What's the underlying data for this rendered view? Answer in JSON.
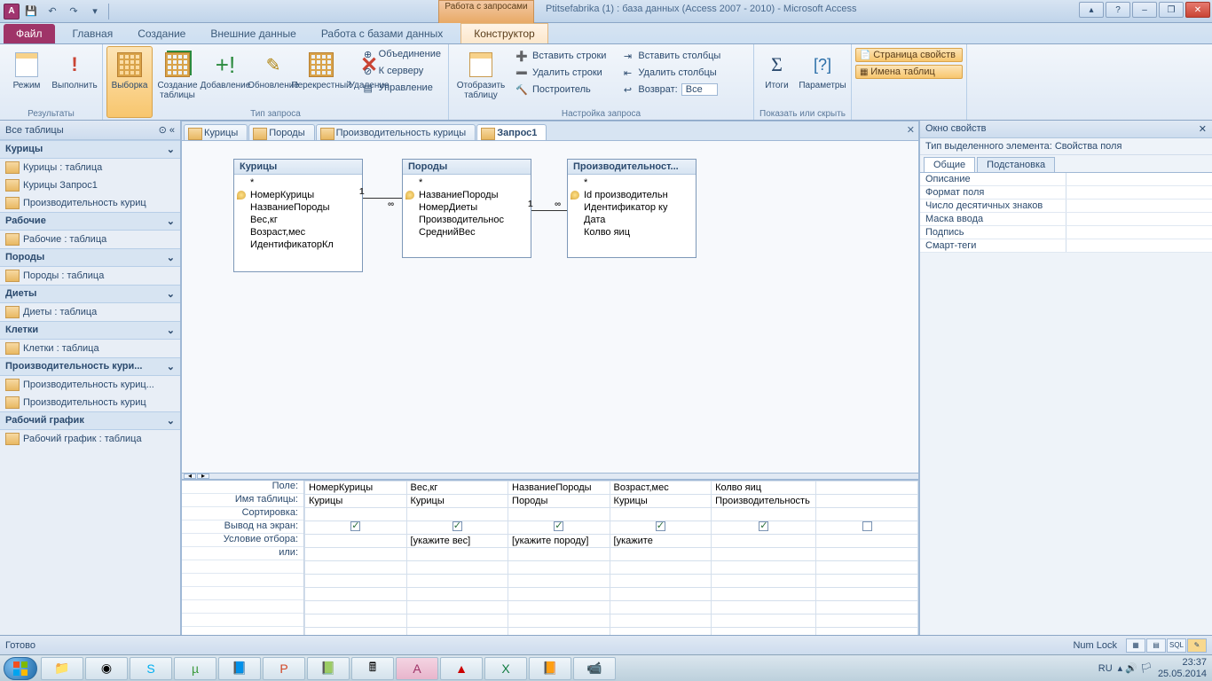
{
  "title": "Ptitsefabrika (1) : база данных (Access 2007 - 2010)  -  Microsoft Access",
  "context_group": "Работа с запросами",
  "tabs": {
    "file": "Файл",
    "home": "Главная",
    "create": "Создание",
    "ext": "Внешние данные",
    "db": "Работа с базами данных",
    "design": "Конструктор"
  },
  "ribbon": {
    "results": {
      "label": "Результаты",
      "view": "Режим",
      "run": "Выполнить"
    },
    "qtype": {
      "label": "Тип запроса",
      "select": "Выборка",
      "maketable": "Создание таблицы",
      "append": "Добавление",
      "update": "Обновление",
      "crosstab": "Перекрестный",
      "delete": "Удаление",
      "union": "Объединение",
      "passthrough": "К серверу",
      "ddl": "Управление"
    },
    "showtable": {
      "btn": "Отобразить таблицу"
    },
    "rows": {
      "insert": "Вставить строки",
      "delete": "Удалить строки",
      "builder": "Построитель"
    },
    "cols": {
      "insert": "Вставить столбцы",
      "delete": "Удалить столбцы",
      "return": "Возврат:",
      "return_val": "Все"
    },
    "setup_label": "Настройка запроса",
    "totals": "Итоги",
    "params": "Параметры",
    "showhide": {
      "label": "Показать или скрыть",
      "propsheet": "Страница свойств",
      "tablenames": "Имена таблиц"
    }
  },
  "nav": {
    "title": "Все таблицы",
    "groups": [
      {
        "h": "Курицы",
        "items": [
          "Курицы : таблица",
          "Курицы Запрос1",
          "Производительность куриц"
        ]
      },
      {
        "h": "Рабочие",
        "items": [
          "Рабочие : таблица"
        ]
      },
      {
        "h": "Породы",
        "items": [
          "Породы : таблица"
        ]
      },
      {
        "h": "Диеты",
        "items": [
          "Диеты : таблица"
        ]
      },
      {
        "h": "Клетки",
        "items": [
          "Клетки : таблица"
        ]
      },
      {
        "h": "Производительность кури...",
        "items": [
          "Производительность куриц...",
          "Производительность куриц"
        ]
      },
      {
        "h": "Рабочий график",
        "items": [
          "Рабочий график : таблица"
        ]
      }
    ]
  },
  "objtabs": [
    "Курицы",
    "Породы",
    "Производительность курицы",
    "Запрос1"
  ],
  "active_tab": 3,
  "tables": [
    {
      "title": "Курицы",
      "fields": [
        "*",
        "НомерКурицы",
        "НазваниеПороды",
        "Вес,кг",
        "Возраст,мес",
        "ИдентификаторКл"
      ],
      "pk": 1
    },
    {
      "title": "Породы",
      "fields": [
        "*",
        "НазваниеПороды",
        "НомерДиеты",
        "Производительнос",
        "СреднийВес"
      ],
      "pk": 1
    },
    {
      "title": "Производительност...",
      "fields": [
        "*",
        "Id производительн",
        "Идентификатор ку",
        "Дата",
        "Колво яиц"
      ],
      "pk": 1
    }
  ],
  "joins": [
    {
      "l": "1",
      "r": "∞"
    },
    {
      "l": "1",
      "r": "∞"
    }
  ],
  "grid_labels": [
    "Поле:",
    "Имя таблицы:",
    "Сортировка:",
    "Вывод на экран:",
    "Условие отбора:",
    "или:"
  ],
  "grid_cols": [
    {
      "field": "НомерКурицы",
      "table": "Курицы",
      "show": true,
      "crit": ""
    },
    {
      "field": "Вес,кг",
      "table": "Курицы",
      "show": true,
      "crit": "[укажите вес]"
    },
    {
      "field": "НазваниеПороды",
      "table": "Породы",
      "show": true,
      "crit": "[укажите породу]"
    },
    {
      "field": "Возраст,мес",
      "table": "Курицы",
      "show": true,
      "crit": "[укажите "
    },
    {
      "field": "Колво яиц",
      "table": "Производительность",
      "show": true,
      "crit": ""
    },
    {
      "field": "",
      "table": "",
      "show": false,
      "crit": ""
    }
  ],
  "prop": {
    "title": "Окно свойств",
    "sub": "Тип выделенного элемента:  Свойства поля",
    "tab1": "Общие",
    "tab2": "Подстановка",
    "rows": [
      "Описание",
      "Формат поля",
      "Число десятичных знаков",
      "Маска ввода",
      "Подпись",
      "Смарт-теги"
    ]
  },
  "status": {
    "ready": "Готово",
    "numlock": "Num Lock"
  },
  "tray": {
    "lang": "RU",
    "time": "23:37",
    "date": "25.05.2014"
  }
}
